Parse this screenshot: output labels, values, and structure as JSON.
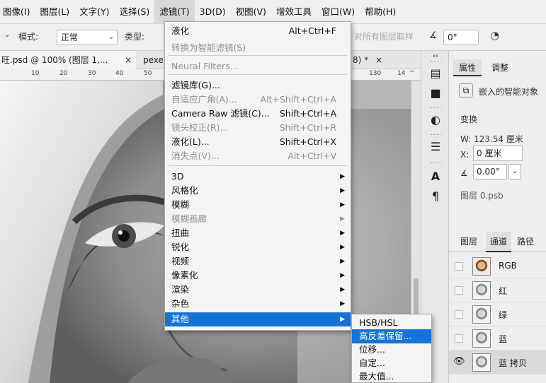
{
  "menubar": [
    "图像(I)",
    "图层(L)",
    "文字(Y)",
    "选择(S)",
    "滤镜(T)",
    "3D(D)",
    "视图(V)",
    "增效工具",
    "窗口(W)",
    "帮助(H)"
  ],
  "options": {
    "mode_label": "模式:",
    "mode_value": "正常",
    "type_label": "类型:",
    "sample_text": "对所有图层取样",
    "angle_value": "0°"
  },
  "tabs": [
    "旺.psd @ 100% (图层 1,...",
    "pexe",
    "8) *"
  ],
  "ruler": [
    "10",
    "20",
    "30",
    "40",
    "50",
    "130",
    "14"
  ],
  "filter_menu": [
    {
      "label": "液化",
      "shortcut": "Alt+Ctrl+F",
      "disabled": false,
      "submenu": false
    },
    {
      "label": "转换为智能滤镜(S)",
      "shortcut": "",
      "disabled": true,
      "submenu": false
    },
    {
      "label": "Neural Filters...",
      "shortcut": "",
      "disabled": true,
      "submenu": false
    },
    {
      "label": "滤镜库(G)...",
      "shortcut": "",
      "disabled": false,
      "submenu": false
    },
    {
      "label": "自适应广角(A)...",
      "shortcut": "Alt+Shift+Ctrl+A",
      "disabled": true,
      "submenu": false
    },
    {
      "label": "Camera Raw 滤镜(C)...",
      "shortcut": "Shift+Ctrl+A",
      "disabled": false,
      "submenu": false
    },
    {
      "label": "镜头校正(R)...",
      "shortcut": "Shift+Ctrl+R",
      "disabled": true,
      "submenu": false
    },
    {
      "label": "液化(L)...",
      "shortcut": "Shift+Ctrl+X",
      "disabled": false,
      "submenu": false
    },
    {
      "label": "消失点(V)...",
      "shortcut": "Alt+Ctrl+V",
      "disabled": true,
      "submenu": false
    },
    {
      "label": "3D",
      "shortcut": "",
      "disabled": false,
      "submenu": true
    },
    {
      "label": "风格化",
      "shortcut": "",
      "disabled": false,
      "submenu": true
    },
    {
      "label": "模糊",
      "shortcut": "",
      "disabled": false,
      "submenu": true
    },
    {
      "label": "模糊画廊",
      "shortcut": "",
      "disabled": true,
      "submenu": true
    },
    {
      "label": "扭曲",
      "shortcut": "",
      "disabled": false,
      "submenu": true
    },
    {
      "label": "锐化",
      "shortcut": "",
      "disabled": false,
      "submenu": true
    },
    {
      "label": "视频",
      "shortcut": "",
      "disabled": false,
      "submenu": true
    },
    {
      "label": "像素化",
      "shortcut": "",
      "disabled": false,
      "submenu": true
    },
    {
      "label": "渲染",
      "shortcut": "",
      "disabled": false,
      "submenu": true
    },
    {
      "label": "杂色",
      "shortcut": "",
      "disabled": false,
      "submenu": true
    },
    {
      "label": "其他",
      "shortcut": "",
      "disabled": false,
      "submenu": true,
      "highlighted": true
    }
  ],
  "submenu": [
    {
      "label": "HSB/HSL",
      "highlighted": false
    },
    {
      "label": "高反差保留...",
      "highlighted": true
    },
    {
      "label": "位移...",
      "highlighted": false
    },
    {
      "label": "自定...",
      "highlighted": false
    },
    {
      "label": "最大值...",
      "highlighted": false
    }
  ],
  "properties": {
    "tabs": [
      "属性",
      "调整"
    ],
    "smart_object": "嵌入的智能对象",
    "transform_label": "变换",
    "w": "W:  123.54 厘米",
    "x_label": "X:",
    "x_value": "0 厘米",
    "angle": "0.00°",
    "layer_file": "图层 0.psb"
  },
  "layers": {
    "tabs": [
      "图层",
      "通道",
      "路径"
    ],
    "channels": [
      {
        "name": "RGB",
        "visible": false,
        "selected": false
      },
      {
        "name": "红",
        "visible": false,
        "selected": false
      },
      {
        "name": "绿",
        "visible": false,
        "selected": false
      },
      {
        "name": "蓝",
        "visible": false,
        "selected": false
      },
      {
        "name": "蓝 拷贝",
        "visible": true,
        "selected": true
      }
    ]
  },
  "colors": {
    "highlight": "#1573d6",
    "menu_bg": "#f4f4f4"
  }
}
